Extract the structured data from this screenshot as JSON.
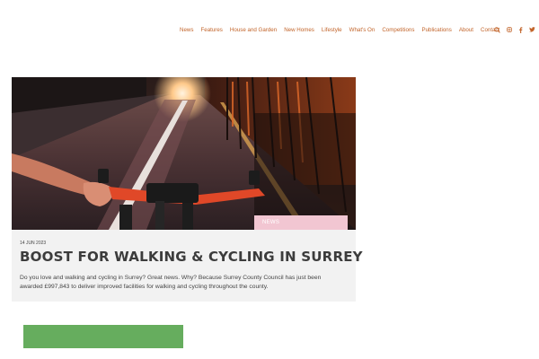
{
  "nav": {
    "items": [
      "News",
      "Features",
      "House and Garden",
      "New Homes",
      "Lifestyle",
      "What's On",
      "Competitions",
      "Publications",
      "About",
      "Contact"
    ]
  },
  "icons": {
    "search": "search-icon",
    "instagram": "instagram-icon",
    "facebook": "facebook-icon",
    "twitter": "twitter-icon"
  },
  "colors": {
    "accent": "#c2642a",
    "badge": "#f2c6d2",
    "card_bg": "#f2f2f2",
    "green_block": "#66ad5e"
  },
  "article": {
    "category": "NEWS",
    "date": "14 JUN 2023",
    "title": "BOOST FOR WALKING & CYCLING IN SURREY",
    "excerpt": "Do you love and walking and cycling in Surrey? Great news. Why? Because Surrey County Council has just been awarded £997,843 to deliver improved facilities for walking and cycling throughout the county."
  }
}
